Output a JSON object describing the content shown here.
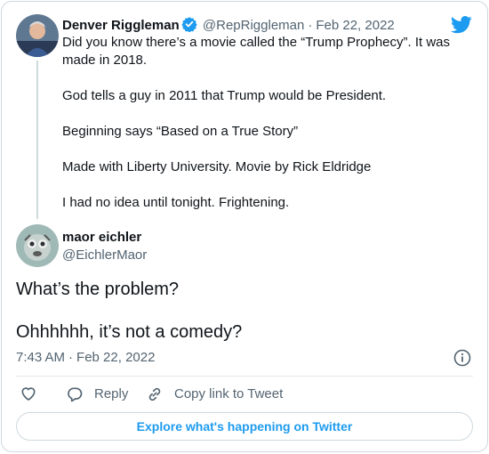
{
  "parent_tweet": {
    "author_name": "Denver Riggleman",
    "author_handle": "@RepRiggleman",
    "date": "Feb 22, 2022",
    "paragraphs": [
      "Did you know there’s a movie called the “Trump Prophecy”. It was made in 2018.",
      "God tells a guy in 2011 that Trump would be President.",
      "Beginning says “Based on a True Story”",
      "Made with Liberty University. Movie by Rick Eldridge",
      "I had no idea until tonight. Frightening."
    ],
    "verified_icon": "verified-badge-icon",
    "brand_icon": "twitter-bird-icon"
  },
  "tweet": {
    "author_name": "maor eichler",
    "author_handle": "@EichlerMaor",
    "paragraphs": [
      "What’s the problem?",
      "Ohhhhhh, it’s not a comedy?"
    ],
    "time": "7:43 AM",
    "date": "Feb 22, 2022"
  },
  "actions": {
    "like_icon": "heart-icon",
    "reply_label": "Reply",
    "copy_link_label": "Copy link to Tweet"
  },
  "explore_label": "Explore what's happening on Twitter",
  "colors": {
    "accent": "#1d9bf0",
    "text": "#0f1419",
    "muted": "#536471",
    "border": "#cfd9de"
  }
}
